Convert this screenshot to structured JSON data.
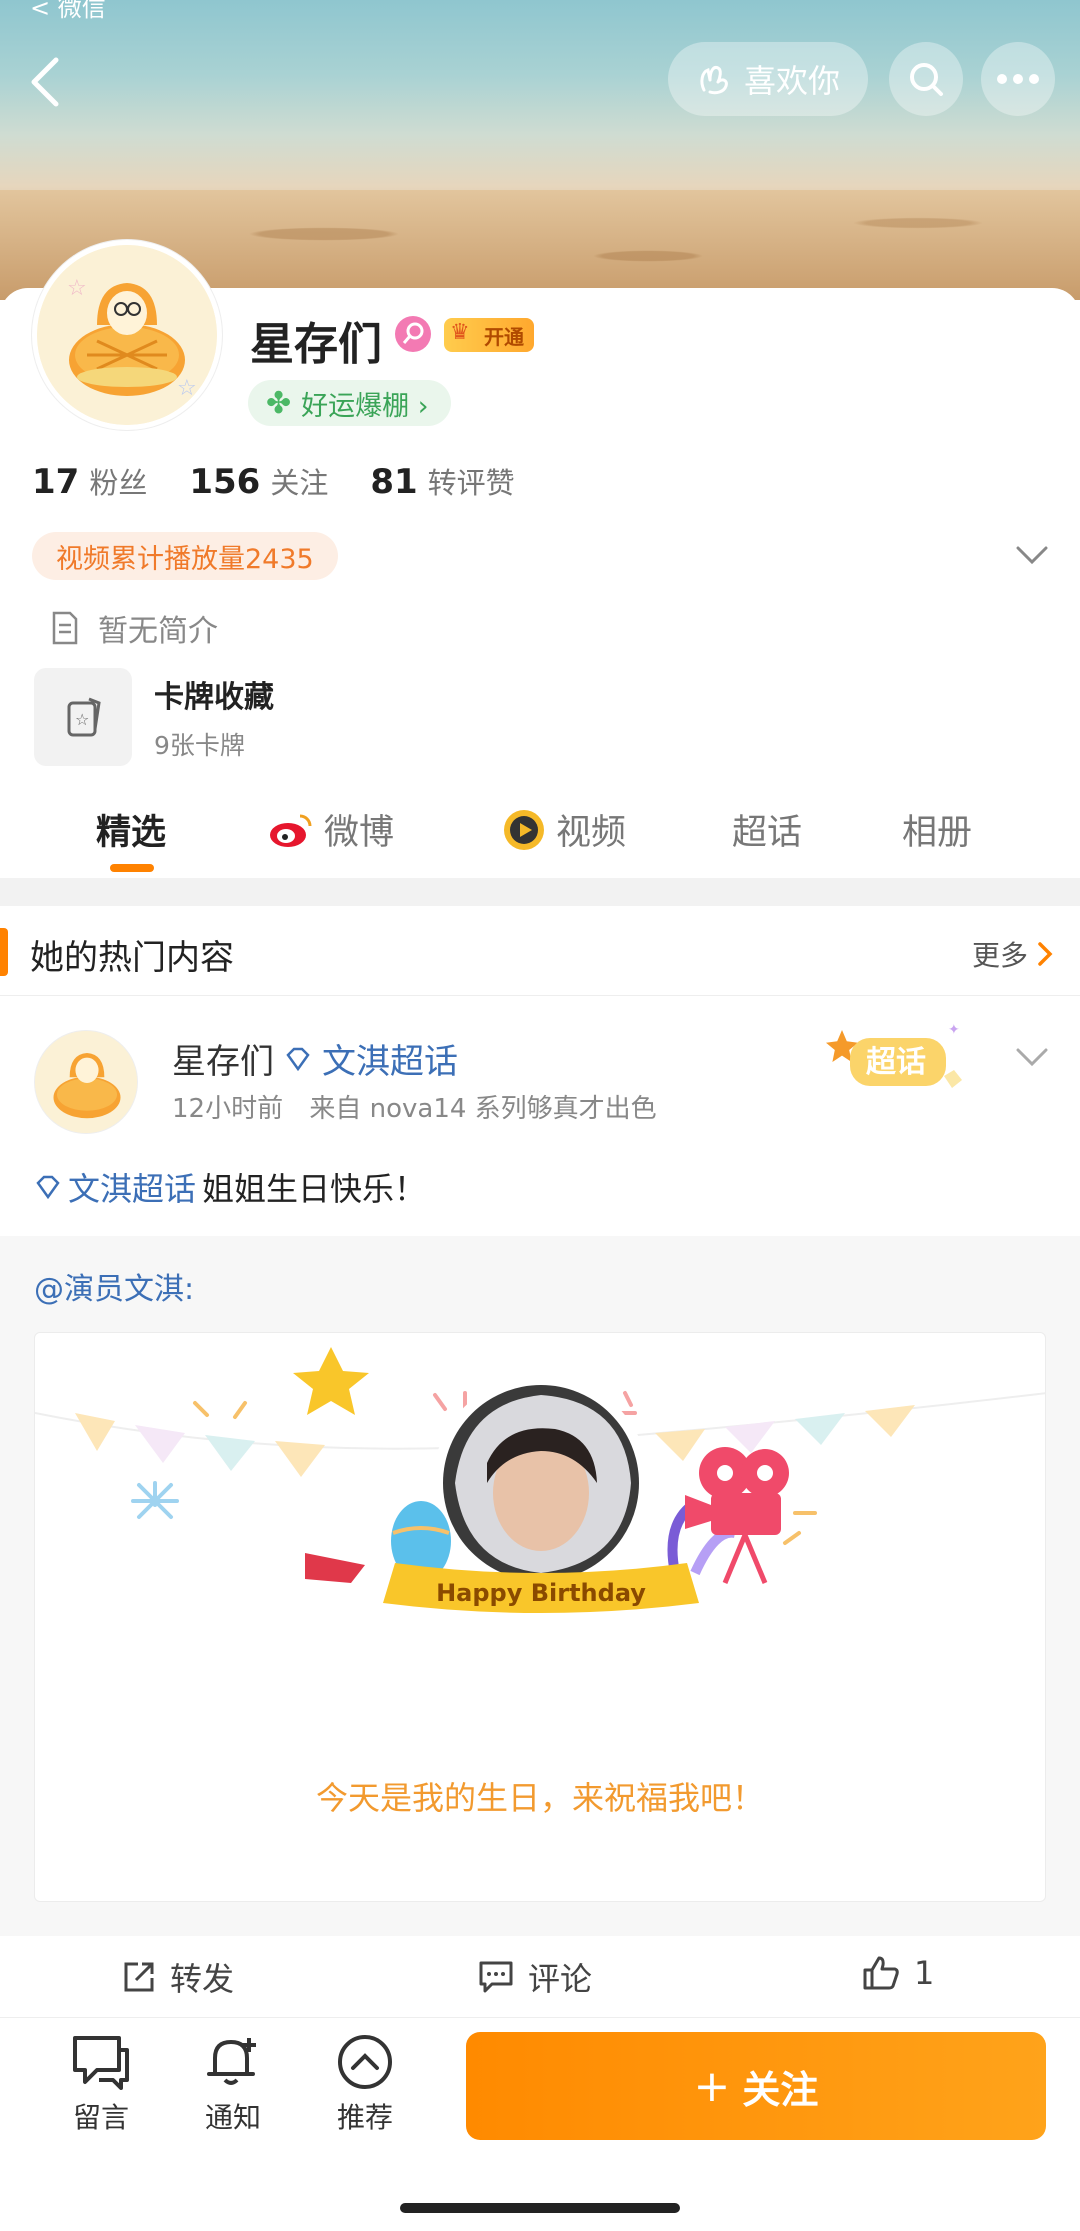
{
  "header": {
    "status_back_label": "< 微信",
    "like_label": "喜欢你"
  },
  "profile": {
    "name": "星存们",
    "vip_label": "开通",
    "luck_label": "好运爆棚 ›",
    "stats": [
      {
        "num": "17",
        "label": "粉丝"
      },
      {
        "num": "156",
        "label": "关注"
      },
      {
        "num": "81",
        "label": "转评赞"
      }
    ],
    "video_stat": "视频累计播放量2435",
    "bio": "暂无简介",
    "cards_title": "卡牌收藏",
    "cards_sub": "9张卡牌"
  },
  "tabs": [
    {
      "label": "精选",
      "active": true
    },
    {
      "label": "微博"
    },
    {
      "label": "视频"
    },
    {
      "label": "超话"
    },
    {
      "label": "相册"
    }
  ],
  "hot": {
    "title": "她的热门内容",
    "more": "更多"
  },
  "post": {
    "author": "星存们",
    "topic": "文淇超话",
    "time": "12小时前",
    "source": "来自 nova14 系列够真才出色",
    "sticker": "超话",
    "text_topic": "文淇超话",
    "text_body": " 姐姐生日快乐！",
    "repost_author": "@演员文淇:",
    "banner_text": "Happy Birthday",
    "birthday_msg": "今天是我的生日，来祝福我吧！"
  },
  "actions": {
    "repost": "转发",
    "comment": "评论",
    "like_count": "1"
  },
  "bottom": {
    "message": "留言",
    "notify": "通知",
    "recommend": "推荐",
    "follow": "关注"
  },
  "colors": {
    "accent": "#ff8200",
    "link": "#3c6fb6",
    "luck_green": "#3aa457"
  }
}
